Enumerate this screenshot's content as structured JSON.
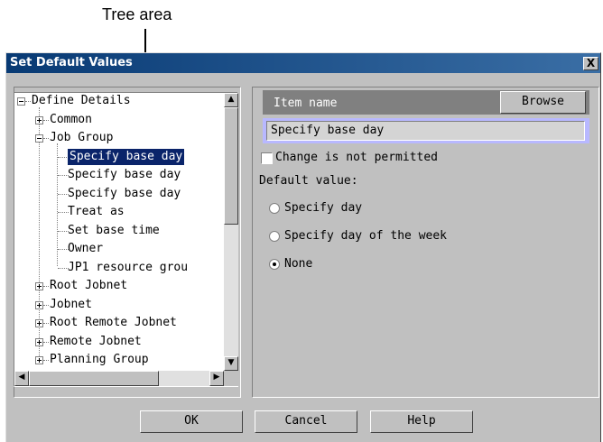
{
  "annotation": {
    "label": "Tree area"
  },
  "window": {
    "title": "Set Default Values",
    "close_label": "X"
  },
  "tree": {
    "nodes": [
      {
        "label": "Define Details",
        "level": 0,
        "expander": "minus"
      },
      {
        "label": "Common",
        "level": 1,
        "expander": "plus"
      },
      {
        "label": "Job Group",
        "level": 1,
        "expander": "minus"
      },
      {
        "label": "Specify base day",
        "level": 2,
        "selected": true
      },
      {
        "label": "Specify base day",
        "level": 2
      },
      {
        "label": "Specify base day",
        "level": 2
      },
      {
        "label": "Treat as",
        "level": 2
      },
      {
        "label": "Set base time",
        "level": 2
      },
      {
        "label": "Owner",
        "level": 2
      },
      {
        "label": "JP1 resource grou",
        "level": 2
      },
      {
        "label": "Root Jobnet",
        "level": 1,
        "expander": "plus"
      },
      {
        "label": "Jobnet",
        "level": 1,
        "expander": "plus"
      },
      {
        "label": "Root Remote Jobnet",
        "level": 1,
        "expander": "plus"
      },
      {
        "label": "Remote Jobnet",
        "level": 1,
        "expander": "plus"
      },
      {
        "label": "Planning Group",
        "level": 1,
        "expander": "plus"
      }
    ]
  },
  "detail": {
    "item_name_label": "Item name",
    "browse_label": "Browse",
    "item_value": "Specify base day",
    "change_not_permitted": {
      "label": "Change is not permitted",
      "checked": false
    },
    "default_value_label": "Default value:",
    "options": [
      {
        "label": "Specify day",
        "selected": false
      },
      {
        "label": "Specify day of the week",
        "selected": false
      },
      {
        "label": "None",
        "selected": true
      }
    ]
  },
  "buttons": {
    "ok": "OK",
    "cancel": "Cancel",
    "help": "Help"
  },
  "colors": {
    "titlebar": "#0a246a",
    "selection": "#0a246a",
    "dialog_bg": "#c0c0c0",
    "value_highlight": "#b8b8ff"
  }
}
